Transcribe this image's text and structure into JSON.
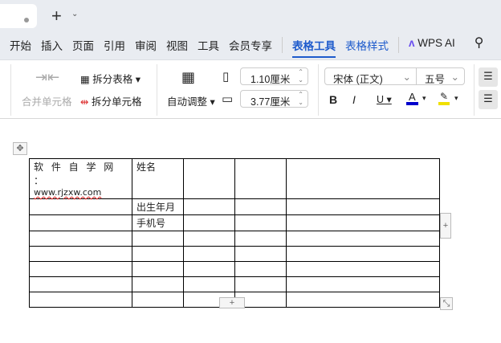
{
  "tabbar": {
    "new_tab": "+",
    "dropdown": "⌄"
  },
  "menu": {
    "items": [
      "开始",
      "插入",
      "页面",
      "引用",
      "审阅",
      "视图",
      "工具",
      "会员专享"
    ],
    "active": "表格工具",
    "second": "表格样式",
    "ai": "WPS AI"
  },
  "ribbon": {
    "merge": "合并单元格",
    "split_table": "拆分表格",
    "split_cell": "拆分单元格",
    "autofit": "自动调整",
    "height": "1.10厘米",
    "width": "3.77厘米",
    "font": "宋体 (正文)",
    "size": "五号",
    "bold": "B",
    "italic": "I",
    "underline": "U",
    "font_color": "A"
  },
  "colors": {
    "accent": "#1e5bcc",
    "font_color": "#0000cc",
    "highlight": "#f0e000"
  },
  "table": {
    "r0c0a": "软 件 自 学 网 ：",
    "r0c0b": "www.rjzxw.com",
    "r0c1": "姓名",
    "r1c1": "出生年月",
    "r2c1": "手机号"
  },
  "handles": {
    "add": "+"
  }
}
